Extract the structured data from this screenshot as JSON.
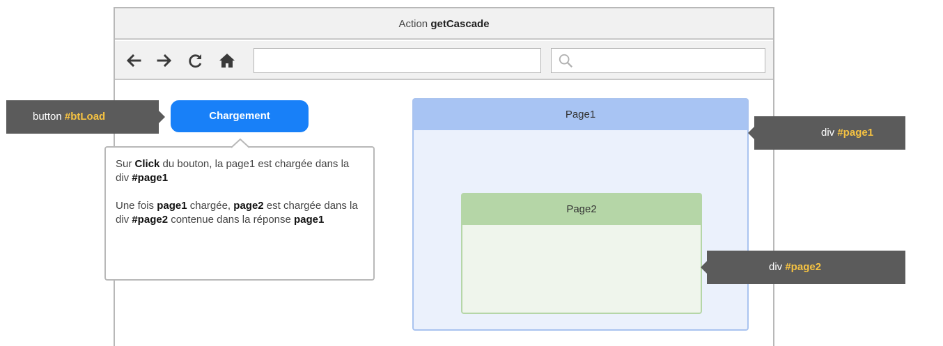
{
  "window": {
    "title_prefix": "Action",
    "title_bold": "getCascade"
  },
  "toolbar": {
    "back_icon": "arrow-left-icon",
    "forward_icon": "arrow-right-icon",
    "reload_icon": "reload-icon",
    "home_icon": "home-icon",
    "url_value": "",
    "search_value": "",
    "search_icon": "search-icon"
  },
  "button": {
    "label": "Chargement"
  },
  "tags": {
    "btLoad": {
      "prefix": "button ",
      "id": "#btLoad"
    },
    "page1": {
      "prefix": "div ",
      "id": "#page1"
    },
    "page2": {
      "prefix": "div ",
      "id": "#page2"
    }
  },
  "tooltip": {
    "p1": {
      "t1": "Sur ",
      "b1": "Click",
      "t2": " du bouton, la page1 est chargée dans la div  ",
      "b2": "#page1"
    },
    "p2": {
      "t1": "Une fois ",
      "b1": "page1",
      "t2": " chargée, ",
      "b2": "page2",
      "t3": " est chargée dans la div ",
      "b3": "#page2",
      "t4": " contenue dans la réponse ",
      "b4": "page1"
    }
  },
  "pages": {
    "page1_title": "Page1",
    "page2_title": "Page2"
  },
  "colors": {
    "button": "#1880f8",
    "tag_bg": "#5b5b5b",
    "tag_highlight": "#f5c242",
    "page1_header": "#a8c4f3",
    "page2_header": "#b5d6a7"
  }
}
